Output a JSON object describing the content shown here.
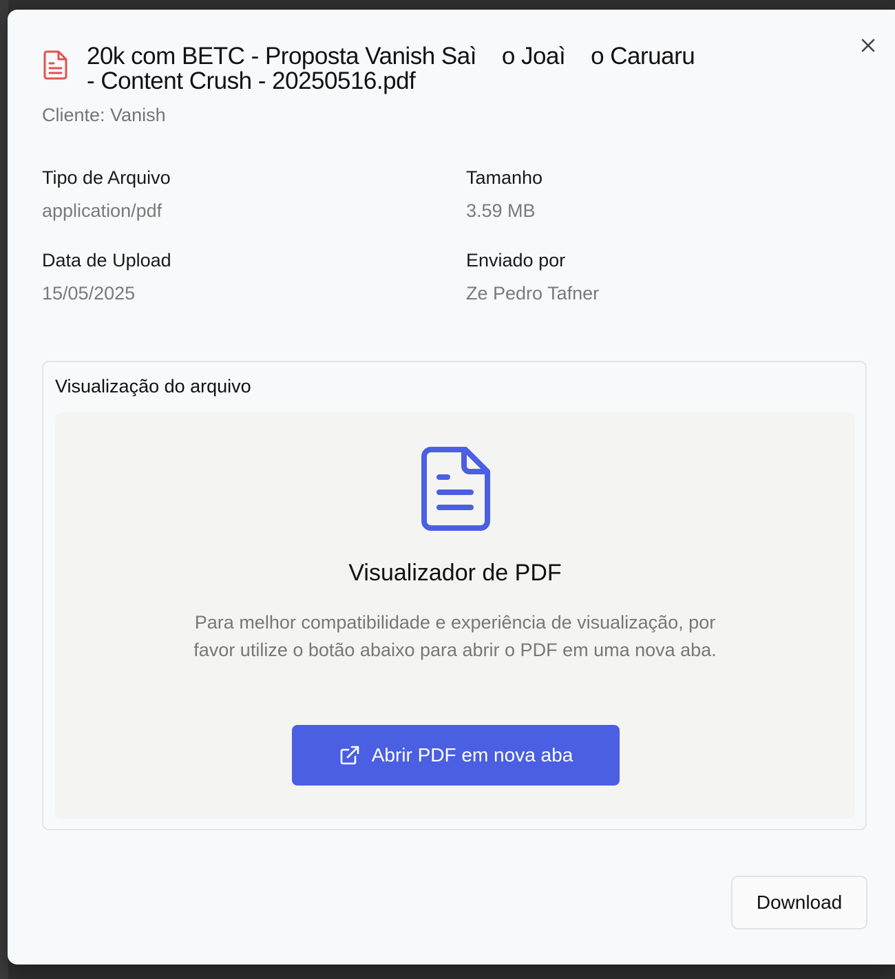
{
  "dialog": {
    "close_label": "close",
    "file_icon": "pdf-file-icon",
    "file_name": "20k com BETC - Proposta Vanish Saì    o Joaì    o Caruaru\n- Content Crush - 20250516.pdf",
    "client_line": "Cliente: Vanish"
  },
  "details": {
    "file_type_label": "Tipo de Arquivo",
    "file_type_value": "application/pdf",
    "size_label": "Tamanho",
    "size_value": "3.59 MB",
    "upload_date_label": "Data de Upload",
    "upload_date_value": "15/05/2025",
    "sent_by_label": "Enviado por",
    "sent_by_value": "Ze Pedro Tafner"
  },
  "preview": {
    "section_title": "Visualização do arquivo",
    "icon": "document-icon",
    "heading": "Visualizador de PDF",
    "description": "Para melhor compatibilidade e experiência de visualização, por favor utilize o botão abaixo para abrir o PDF em uma nova aba.",
    "open_button_label": "Abrir PDF em nova aba",
    "open_button_icon": "external-link-icon"
  },
  "footer": {
    "download_label": "Download"
  },
  "colors": {
    "accent": "#4a5fe2",
    "file_icon_red": "#e0524f",
    "muted_text": "#777777"
  }
}
